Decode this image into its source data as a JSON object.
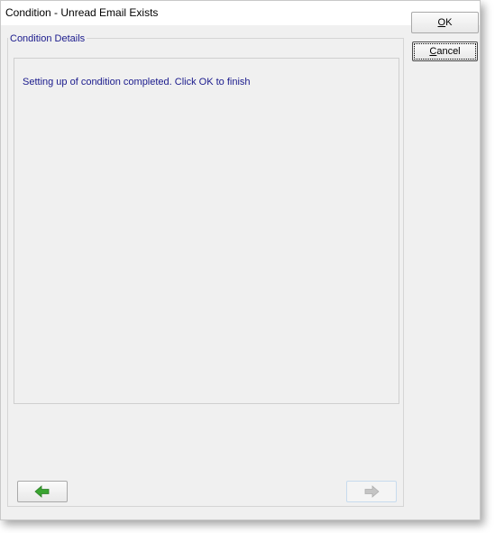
{
  "window": {
    "title": "Condition - Unread Email  Exists"
  },
  "group": {
    "label": "Condition Details"
  },
  "message": "Setting up of condition completed. Click OK to finish",
  "buttons": {
    "ok": {
      "accel": "O",
      "rest": "K"
    },
    "cancel": {
      "accel": "C",
      "rest": "ancel"
    }
  },
  "nav": {
    "back_icon": "arrow-left-icon",
    "next_icon": "arrow-right-icon",
    "back_enabled": true,
    "next_enabled": false
  },
  "colors": {
    "label_text": "#1a1a8c",
    "back_arrow": "#3aa531",
    "next_arrow_disabled": "#b9b9b9"
  }
}
